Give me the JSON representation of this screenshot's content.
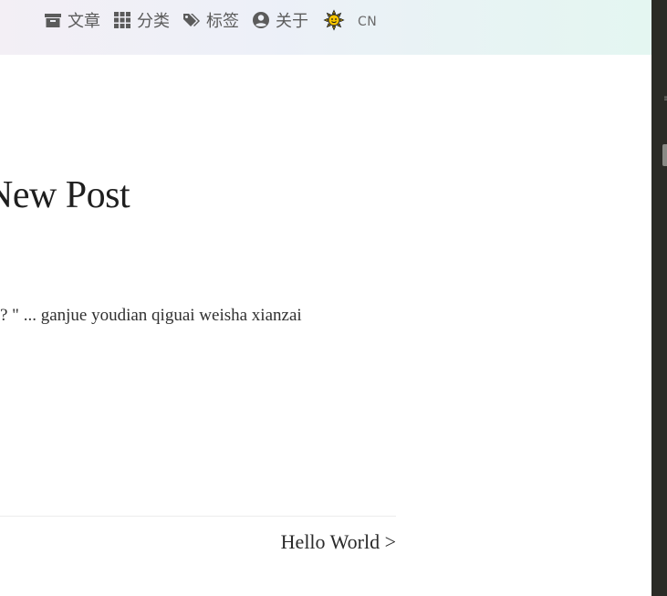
{
  "nav": {
    "items": [
      {
        "label": "文章",
        "icon": "archive-icon"
      },
      {
        "label": "分类",
        "icon": "grid-icon"
      },
      {
        "label": "标签",
        "icon": "tags-icon"
      },
      {
        "label": "关于",
        "icon": "user-circle-icon"
      }
    ],
    "theme_icon": "sun-icon",
    "lang": "CN"
  },
  "post": {
    "title": "New Post",
    "excerpt": "? \" ... ganjue youdian qiguai weisha xianzai"
  },
  "pager": {
    "next_label": "Hello World >"
  },
  "colors": {
    "nav_text": "#5b5b5b",
    "title": "#1f1f1f",
    "sun_yellow": "#f5c400",
    "dark_panel": "#2b2b26"
  }
}
